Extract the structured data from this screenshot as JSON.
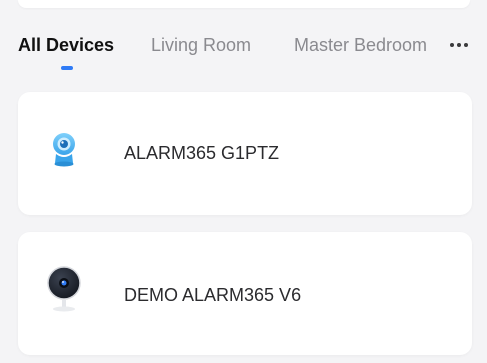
{
  "tabs": [
    {
      "label": "All Devices",
      "active": true
    },
    {
      "label": "Living Room",
      "active": false
    },
    {
      "label": "Master Bedroom",
      "active": false
    }
  ],
  "more_icon": "more-horizontal-icon",
  "devices": [
    {
      "name": "ALARM365 G1PTZ",
      "icon": "ptz-camera-icon"
    },
    {
      "name": "DEMO ALARM365 V6",
      "icon": "dome-camera-icon"
    }
  ],
  "colors": {
    "accent": "#2f7bf6",
    "background": "#f4f4f6",
    "card": "#ffffff",
    "tab_inactive": "#8a8a8f",
    "tab_active": "#111111",
    "camera_blue": "#4fb6f0"
  }
}
